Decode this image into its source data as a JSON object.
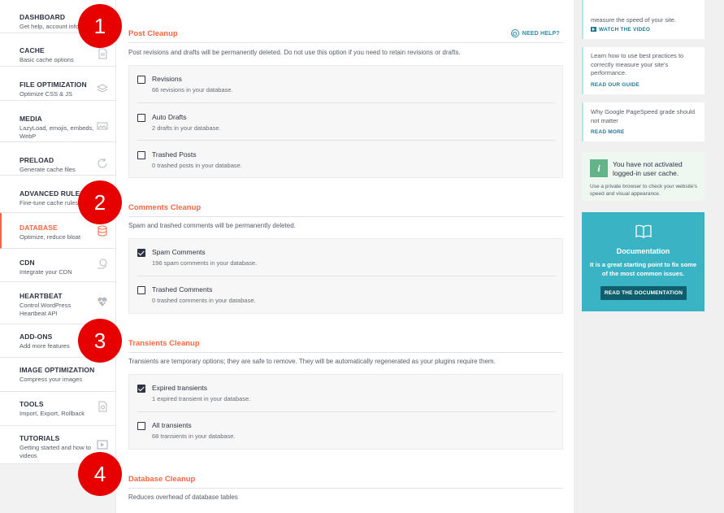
{
  "sidebar": {
    "items": [
      {
        "title": "DASHBOARD",
        "desc": "Get help, account info",
        "icon": "home-icon"
      },
      {
        "title": "CACHE",
        "desc": "Basic cache options",
        "icon": "page-icon"
      },
      {
        "title": "FILE OPTIMIZATION",
        "desc": "Optimize CSS & JS",
        "icon": "layers-icon"
      },
      {
        "title": "MEDIA",
        "desc": "LazyLoad, emojis, embeds, WebP",
        "icon": "image-icon"
      },
      {
        "title": "PRELOAD",
        "desc": "Generate cache files",
        "icon": "refresh-icon"
      },
      {
        "title": "ADVANCED RULES",
        "desc": "Fine-tune cache rules",
        "icon": "list-icon"
      },
      {
        "title": "DATABASE",
        "desc": "Optimize, reduce bloat",
        "icon": "database-icon"
      },
      {
        "title": "CDN",
        "desc": "Integrate your CDN",
        "icon": "globe-hand-icon"
      },
      {
        "title": "HEARTBEAT",
        "desc": "Control WordPress Heartbeat API",
        "icon": "heartbeat-icon"
      },
      {
        "title": "ADD-ONS",
        "desc": "Add more features",
        "icon": "addons-icon"
      },
      {
        "title": "IMAGE OPTIMIZATION",
        "desc": "Compress your images",
        "icon": "image-optimize-icon"
      },
      {
        "title": "TOOLS",
        "desc": "Import, Export, Rollback",
        "icon": "tools-icon"
      },
      {
        "title": "TUTORIALS",
        "desc": "Getting started and how to videos",
        "icon": "video-icon"
      }
    ]
  },
  "callouts": [
    "1",
    "2",
    "3",
    "4"
  ],
  "main": {
    "help_label": "NEED HELP?",
    "sections": [
      {
        "title": "Post Cleanup",
        "desc": "Post revisions and drafts will be permanently deleted. Do not use this option if you need to retain revisions or drafts.",
        "options": [
          {
            "label": "Revisions",
            "sub": "66 revisions in your database.",
            "checked": false
          },
          {
            "label": "Auto Drafts",
            "sub": "2 drafts in your database.",
            "checked": false
          },
          {
            "label": "Trashed Posts",
            "sub": "0 trashed posts in your database.",
            "checked": false
          }
        ]
      },
      {
        "title": "Comments Cleanup",
        "desc": "Spam and trashed comments will be permanently deleted.",
        "options": [
          {
            "label": "Spam Comments",
            "sub": "196 spam comments in your database.",
            "checked": true
          },
          {
            "label": "Trashed Comments",
            "sub": "0 trashed comments in your database.",
            "checked": false
          }
        ]
      },
      {
        "title": "Transients Cleanup",
        "desc": "Transients are temporary options; they are safe to remove. They will be automatically regenerated as your plugins require them.",
        "options": [
          {
            "label": "Expired transients",
            "sub": "1 expired transient in your database.",
            "checked": true
          },
          {
            "label": "All transients",
            "sub": "68 transients in your database.",
            "checked": false
          }
        ]
      },
      {
        "title": "Database Cleanup",
        "desc": "Reduces overhead of database tables",
        "options": []
      }
    ]
  },
  "right": {
    "card1": {
      "text": "measure the speed of your site.",
      "link": "WATCH THE VIDEO"
    },
    "card2": {
      "text": "Learn how to use best practices to correctly measure your site's performance.",
      "link": "READ OUR GUIDE"
    },
    "card3": {
      "text": "Why Google PageSpeed grade should not matter",
      "link": "READ MORE"
    },
    "notice": {
      "icon": "i",
      "title": "You have not activated logged-in user cache.",
      "sub": "Use a private browser to check your website's speed and visual appearance."
    },
    "doc": {
      "title": "Documentation",
      "text": "It is a great starting point to fix some of the most common issues.",
      "button": "READ THE DOCUMENTATION"
    }
  },
  "colors": {
    "accent": "#f56640",
    "teal": "#3ab4c5",
    "dark_teal": "#0f5e6e",
    "callout_red": "#e60000"
  }
}
